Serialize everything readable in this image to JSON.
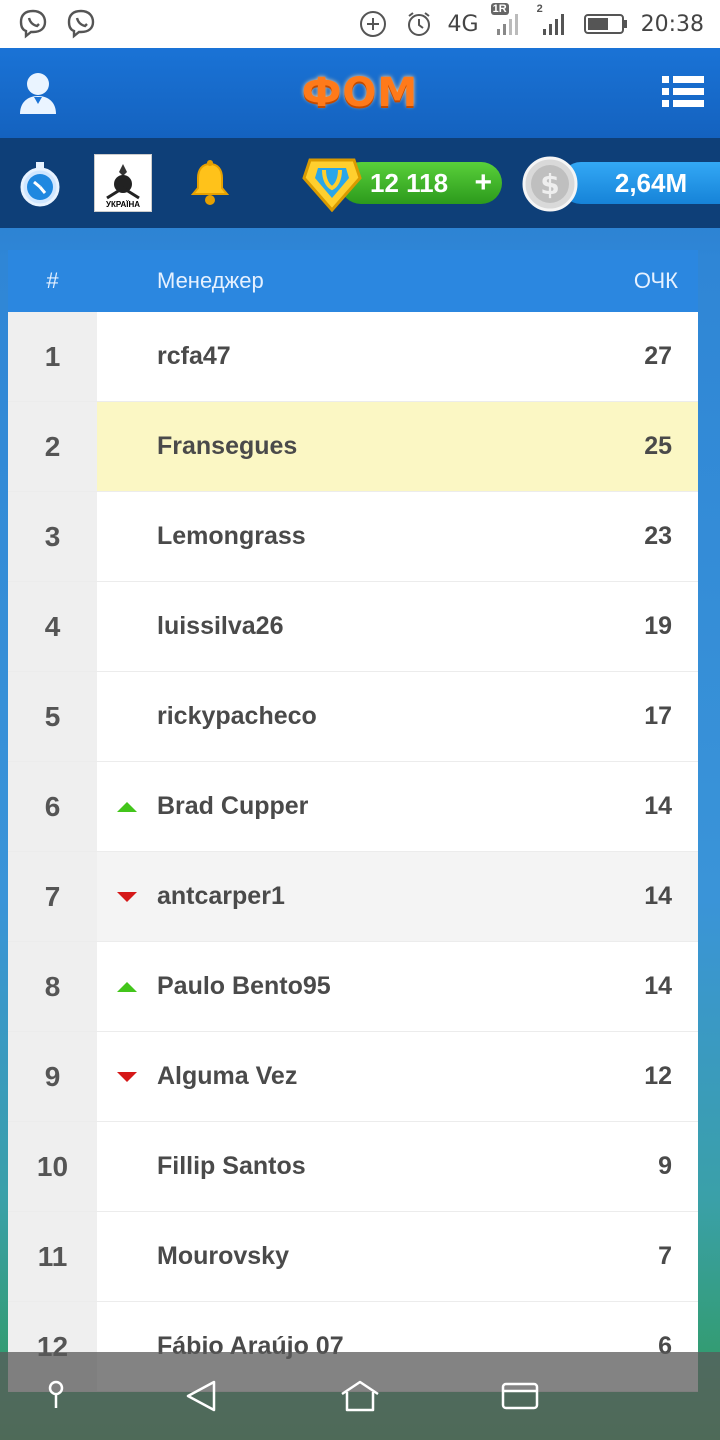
{
  "status_bar": {
    "time": "20:38",
    "network": "4G",
    "sim1_badge": "1R",
    "sim2_badge": "2",
    "icons": [
      "viber-icon",
      "viber-icon",
      "add-circle-icon",
      "alarm-icon",
      "signal-icon",
      "signal-icon",
      "battery-icon"
    ]
  },
  "header": {
    "logo": "ФОМ",
    "icons": [
      "user-icon",
      "menu-icon"
    ]
  },
  "toolbar": {
    "crest_label": "УКРАЇНА",
    "gems": "12 118",
    "gems_add": "+",
    "coins": "2,64M",
    "icons": [
      "stopwatch-icon",
      "bell-icon",
      "gem-icon",
      "dollar-coin-icon"
    ]
  },
  "table": {
    "headers": {
      "rank": "#",
      "manager": "Менеджер",
      "points": "ОЧК"
    },
    "rows": [
      {
        "rank": "1",
        "name": "rcfa47",
        "points": "27",
        "trend": ""
      },
      {
        "rank": "2",
        "name": "Fransegues",
        "points": "25",
        "trend": ""
      },
      {
        "rank": "3",
        "name": "Lemongrass",
        "points": "23",
        "trend": ""
      },
      {
        "rank": "4",
        "name": "luissilva26",
        "points": "19",
        "trend": ""
      },
      {
        "rank": "5",
        "name": "rickypacheco",
        "points": "17",
        "trend": ""
      },
      {
        "rank": "6",
        "name": "Brad Cupper",
        "points": "14",
        "trend": "up"
      },
      {
        "rank": "7",
        "name": "antcarper1",
        "points": "14",
        "trend": "down"
      },
      {
        "rank": "8",
        "name": "Paulo Bento95",
        "points": "14",
        "trend": "up"
      },
      {
        "rank": "9",
        "name": "Alguma Vez",
        "points": "12",
        "trend": "down"
      },
      {
        "rank": "10",
        "name": "Fillip Santos",
        "points": "9",
        "trend": ""
      },
      {
        "rank": "11",
        "name": "Mourovsky",
        "points": "7",
        "trend": ""
      },
      {
        "rank": "12",
        "name": "Fábio Araújo 07",
        "points": "6",
        "trend": ""
      }
    ]
  },
  "nav_bar": {
    "icons": [
      "pin-icon",
      "back-icon",
      "home-icon",
      "recents-icon"
    ]
  },
  "colors": {
    "header_blue": "#1a73d6",
    "toolbar_navy": "#0e3f78",
    "table_header_blue": "#2b87e0",
    "highlight_row": "#fbf7c4",
    "trend_up": "#43c51b",
    "trend_down": "#d51818"
  }
}
